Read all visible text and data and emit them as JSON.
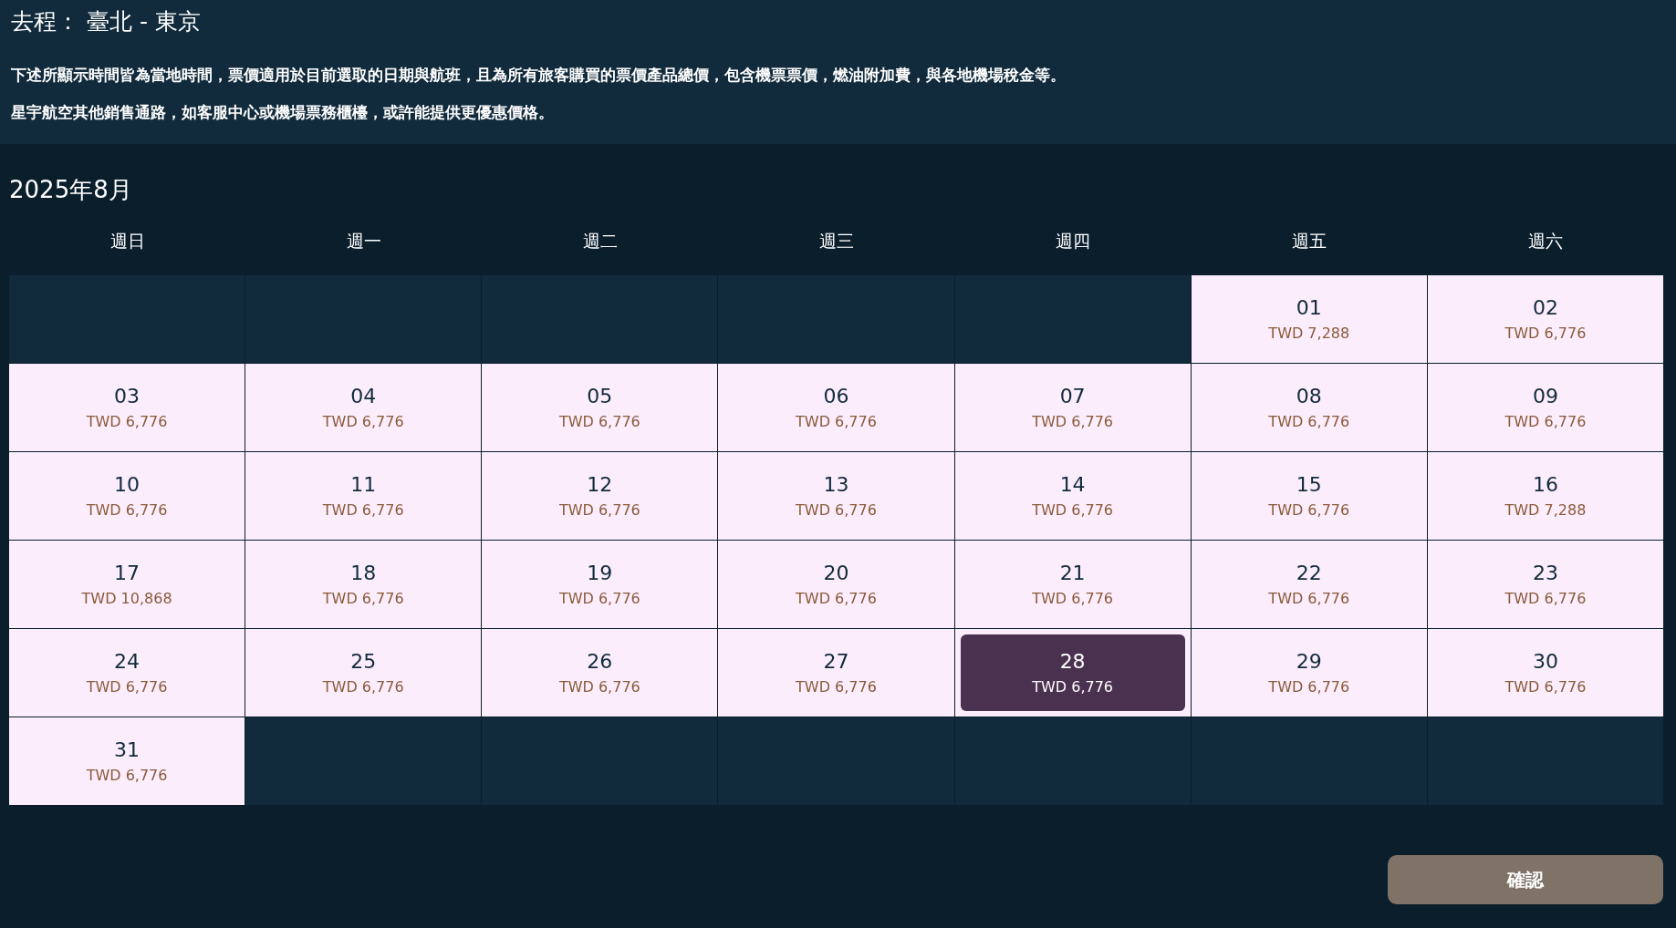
{
  "header": {
    "title": "去程： 臺北 - 東京",
    "notes": [
      "下述所顯示時間皆為當地時間，票價適用於目前選取的日期與航班，且為所有旅客購買的票價產品總價，包含機票票價，燃油附加費，與各地機場稅金等。",
      "星宇航空其他銷售通路，如客服中心或機場票務櫃檯，或許能提供更優惠價格。"
    ]
  },
  "calendar": {
    "month": "2025年8月",
    "weekdays": [
      "週日",
      "週一",
      "週二",
      "週三",
      "週四",
      "週五",
      "週六"
    ],
    "weeks": [
      [
        {
          "kind": "empty"
        },
        {
          "kind": "empty"
        },
        {
          "kind": "empty"
        },
        {
          "kind": "empty"
        },
        {
          "kind": "empty"
        },
        {
          "kind": "day",
          "day": "01",
          "price": "TWD 7,288",
          "selected": false
        },
        {
          "kind": "day",
          "day": "02",
          "price": "TWD 6,776",
          "selected": false
        }
      ],
      [
        {
          "kind": "day",
          "day": "03",
          "price": "TWD 6,776",
          "selected": false
        },
        {
          "kind": "day",
          "day": "04",
          "price": "TWD 6,776",
          "selected": false
        },
        {
          "kind": "day",
          "day": "05",
          "price": "TWD 6,776",
          "selected": false
        },
        {
          "kind": "day",
          "day": "06",
          "price": "TWD 6,776",
          "selected": false
        },
        {
          "kind": "day",
          "day": "07",
          "price": "TWD 6,776",
          "selected": false
        },
        {
          "kind": "day",
          "day": "08",
          "price": "TWD 6,776",
          "selected": false
        },
        {
          "kind": "day",
          "day": "09",
          "price": "TWD 6,776",
          "selected": false
        }
      ],
      [
        {
          "kind": "day",
          "day": "10",
          "price": "TWD 6,776",
          "selected": false
        },
        {
          "kind": "day",
          "day": "11",
          "price": "TWD 6,776",
          "selected": false
        },
        {
          "kind": "day",
          "day": "12",
          "price": "TWD 6,776",
          "selected": false
        },
        {
          "kind": "day",
          "day": "13",
          "price": "TWD 6,776",
          "selected": false
        },
        {
          "kind": "day",
          "day": "14",
          "price": "TWD 6,776",
          "selected": false
        },
        {
          "kind": "day",
          "day": "15",
          "price": "TWD 6,776",
          "selected": false
        },
        {
          "kind": "day",
          "day": "16",
          "price": "TWD 7,288",
          "selected": false
        }
      ],
      [
        {
          "kind": "day",
          "day": "17",
          "price": "TWD 10,868",
          "selected": false
        },
        {
          "kind": "day",
          "day": "18",
          "price": "TWD 6,776",
          "selected": false
        },
        {
          "kind": "day",
          "day": "19",
          "price": "TWD 6,776",
          "selected": false
        },
        {
          "kind": "day",
          "day": "20",
          "price": "TWD 6,776",
          "selected": false
        },
        {
          "kind": "day",
          "day": "21",
          "price": "TWD 6,776",
          "selected": false
        },
        {
          "kind": "day",
          "day": "22",
          "price": "TWD 6,776",
          "selected": false
        },
        {
          "kind": "day",
          "day": "23",
          "price": "TWD 6,776",
          "selected": false
        }
      ],
      [
        {
          "kind": "day",
          "day": "24",
          "price": "TWD 6,776",
          "selected": false
        },
        {
          "kind": "day",
          "day": "25",
          "price": "TWD 6,776",
          "selected": false
        },
        {
          "kind": "day",
          "day": "26",
          "price": "TWD 6,776",
          "selected": false
        },
        {
          "kind": "day",
          "day": "27",
          "price": "TWD 6,776",
          "selected": false
        },
        {
          "kind": "day",
          "day": "28",
          "price": "TWD 6,776",
          "selected": true
        },
        {
          "kind": "day",
          "day": "29",
          "price": "TWD 6,776",
          "selected": false
        },
        {
          "kind": "day",
          "day": "30",
          "price": "TWD 6,776",
          "selected": false
        }
      ],
      [
        {
          "kind": "day",
          "day": "31",
          "price": "TWD 6,776",
          "selected": false
        },
        {
          "kind": "empty"
        },
        {
          "kind": "empty"
        },
        {
          "kind": "empty"
        },
        {
          "kind": "empty"
        },
        {
          "kind": "empty"
        },
        {
          "kind": "empty"
        }
      ]
    ]
  },
  "confirm_button": "確認"
}
